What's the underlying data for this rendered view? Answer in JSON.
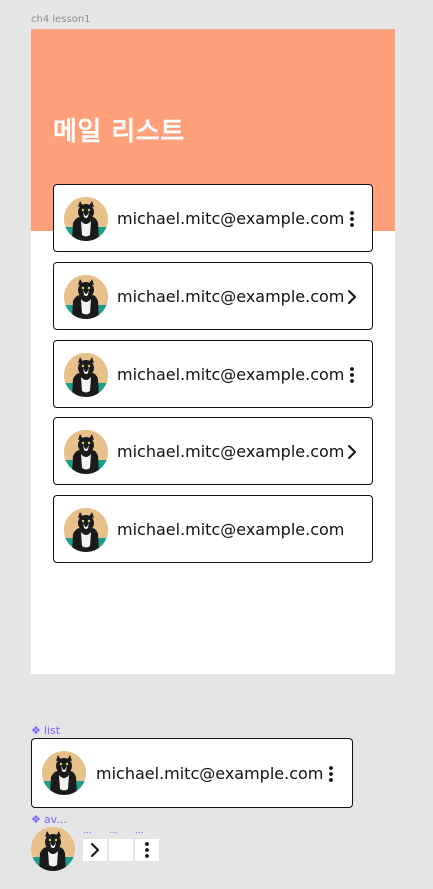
{
  "canvas": {
    "frame_label": "ch4 lesson1",
    "frame_title": "메일 리스트",
    "colors": {
      "header": "#ffa07a",
      "component_label": "#7b61ff",
      "canvas": "#e5e5e5"
    }
  },
  "mail_list": [
    {
      "email": "michael.mitc@example.com",
      "action_icon": "more-vertical-icon"
    },
    {
      "email": "michael.mitc@example.com",
      "action_icon": "chevron-right-icon"
    },
    {
      "email": "michael.mitc@example.com",
      "action_icon": "more-vertical-icon"
    },
    {
      "email": "michael.mitc@example.com",
      "action_icon": "chevron-right-icon"
    },
    {
      "email": "michael.mitc@example.com",
      "action_icon": "none"
    }
  ],
  "components": {
    "list": {
      "label": "list",
      "email": "michael.mitc@example.com",
      "action_icon": "more-vertical-icon"
    },
    "avatar": {
      "label": "av...",
      "icon_labels": [
        "...",
        "...",
        "..."
      ]
    }
  }
}
